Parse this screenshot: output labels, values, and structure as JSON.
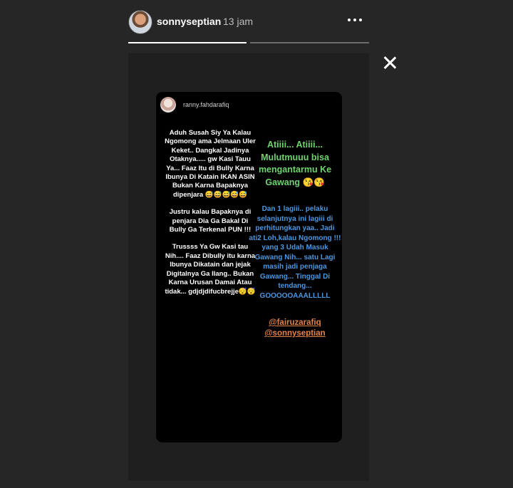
{
  "header": {
    "username": "sonnyseptian",
    "time": "13 jam"
  },
  "story_progress": [
    1.0,
    0.0
  ],
  "card": {
    "username": "ranny.fahdarafiq",
    "left_paragraphs": [
      "Aduh Susah Siy Ya Kalau Ngomong ama Jelmaan Uler Keket.. Dangkal Jadinya Otaknya..... gw Kasi Tauu Ya... Faaz Itu di Bully Karna Ibunya Di Katain IKAN ASIN Bukan Karna Bapaknya dipenjara 😅😅😅😅😅",
      "Justru kalau Bapaknya di penjara Dia Ga Bakal Di Bully Ga Terkenal PUN !!!",
      "Trussss Ya Gw Kasi tau Nih.... Faaz Dibully itu karna Ibunya Dikatain dan jejak Digitalnya Ga Ilang.. Bukan Karna Urusan Damai Atau tidak... gdjdjdifucbrejje😴😴"
    ],
    "green_text": "Atiiii... Atiiii... Mulutmuuu bisa mengantarmu Ke Gawang 😘😘",
    "blue_text": "Dan 1 lagiii.. pelaku selanjutnya ini lagiii di perhitungkan yaa.. Jadi ati2 Loh,kalau Ngomong !!! yang 3 Udah Masuk Gawang Nih... satu Lagi masih jadi penjaga Gawang... Tinggal Di tendang... GOOOOOAAALLLLL",
    "mentions": [
      "@fairuzarafiq",
      "@sonnyseptian"
    ]
  },
  "icons": {
    "more": "more-horizontal-icon",
    "close": "close-icon"
  }
}
